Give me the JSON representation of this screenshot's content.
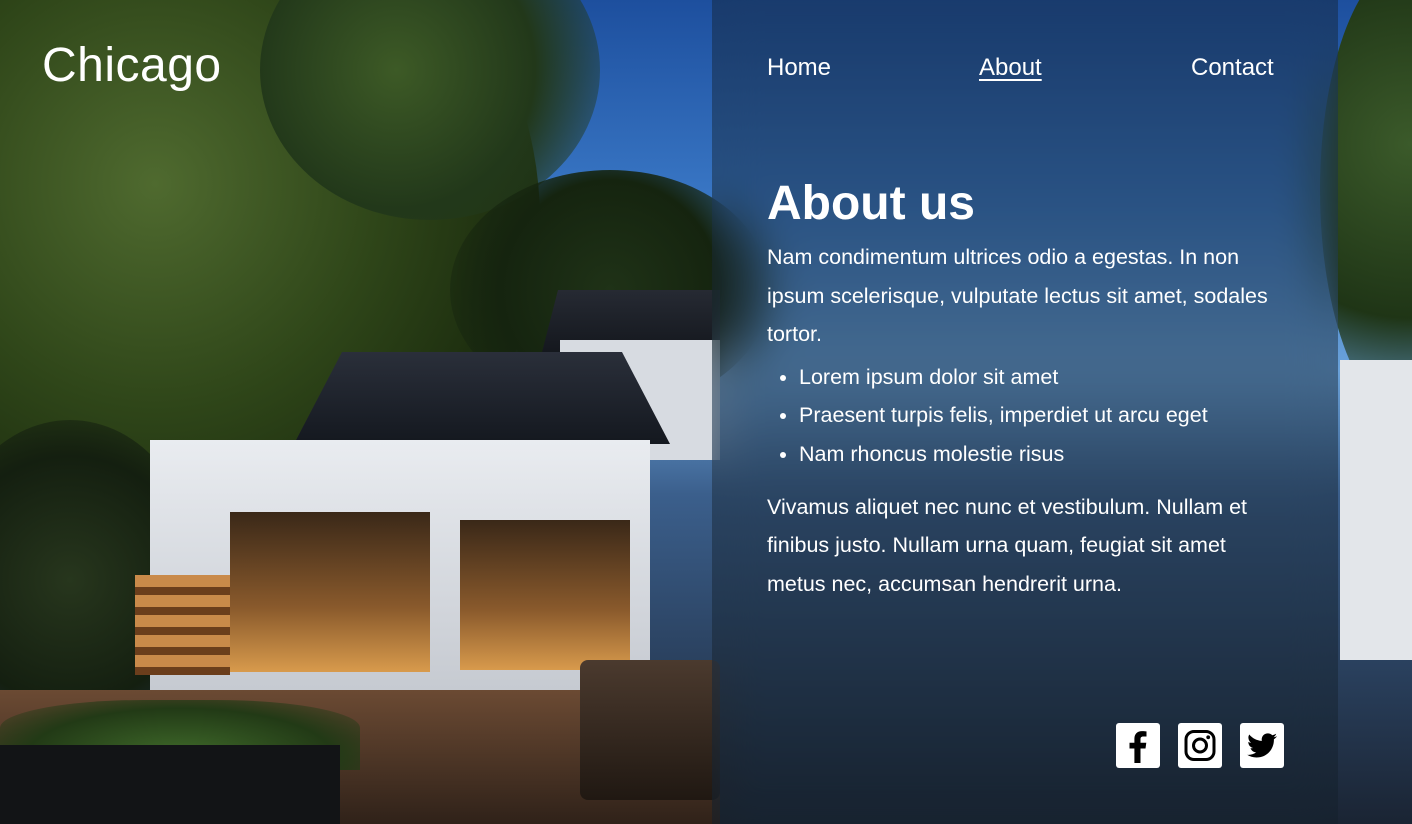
{
  "header": {
    "brand": "Chicago",
    "nav": [
      {
        "label": "Home",
        "active": false
      },
      {
        "label": "About",
        "active": true
      },
      {
        "label": "Contact",
        "active": false
      }
    ]
  },
  "about": {
    "title": "About us",
    "intro": "Nam condimentum ultrices odio a egestas. In non ipsum scelerisque, vulputate lectus sit amet, sodales tortor.",
    "bullets": [
      "Lorem ipsum dolor sit amet",
      "Praesent turpis felis, imperdiet ut arcu eget",
      "Nam rhoncus molestie risus"
    ],
    "outro": "Vivamus aliquet nec nunc et vestibulum. Nullam et finibus justo. Nullam urna quam, feugiat sit amet metus nec, accumsan hendrerit urna."
  },
  "social": [
    {
      "icon": "facebook-icon"
    },
    {
      "icon": "instagram-icon"
    },
    {
      "icon": "twitter-icon"
    }
  ],
  "colors": {
    "text": "#ffffff",
    "panel_overlay": "rgba(20,30,40,0.42)",
    "icon_tile": "#ffffff",
    "icon_glyph": "#000000"
  }
}
